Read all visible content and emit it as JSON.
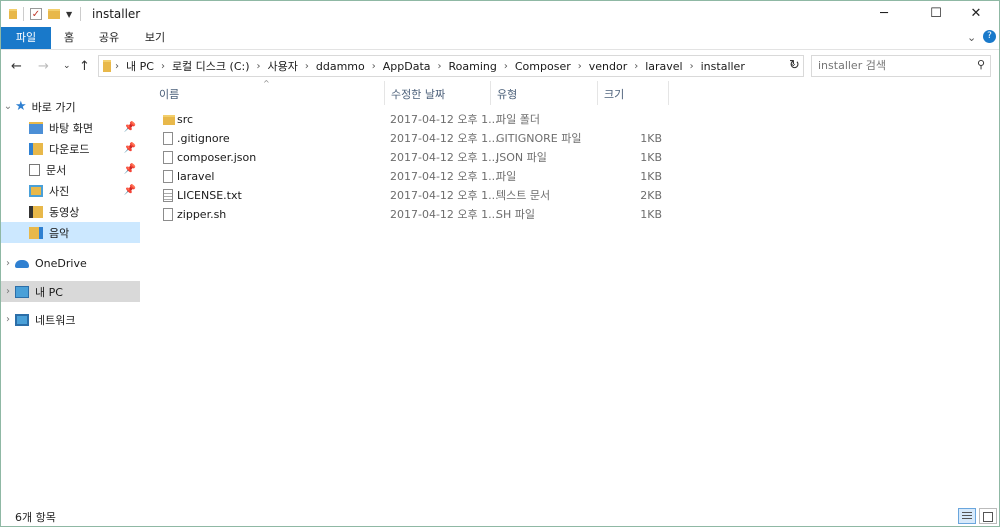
{
  "window": {
    "title": "installer"
  },
  "ribbon": {
    "tabs": [
      "파일",
      "홈",
      "공유",
      "보기"
    ]
  },
  "address": {
    "breadcrumbs": [
      "내 PC",
      "로컬 디스크 (C:)",
      "사용자",
      "ddammo",
      "AppData",
      "Roaming",
      "Composer",
      "vendor",
      "laravel",
      "installer"
    ]
  },
  "search": {
    "placeholder": "installer 검색"
  },
  "nav": {
    "quick_access": "바로 가기",
    "items": [
      {
        "label": "바탕 화면",
        "pinned": true
      },
      {
        "label": "다운로드",
        "pinned": true
      },
      {
        "label": "문서",
        "pinned": true
      },
      {
        "label": "사진",
        "pinned": true
      },
      {
        "label": "동영상",
        "pinned": false
      },
      {
        "label": "음악",
        "pinned": false,
        "selected": true
      }
    ],
    "onedrive": "OneDrive",
    "this_pc": "내 PC",
    "network": "네트워크"
  },
  "columns": {
    "name": "이름",
    "date": "수정한 날짜",
    "type": "유형",
    "size": "크기"
  },
  "files": [
    {
      "name": "src",
      "date": "2017-04-12 오후 1...",
      "type": "파일 폴더",
      "size": "",
      "icon": "folder"
    },
    {
      "name": ".gitignore",
      "date": "2017-04-12 오후 1...",
      "type": "GITIGNORE 파일",
      "size": "1KB",
      "icon": "file"
    },
    {
      "name": "composer.json",
      "date": "2017-04-12 오후 1...",
      "type": "JSON 파일",
      "size": "1KB",
      "icon": "file"
    },
    {
      "name": "laravel",
      "date": "2017-04-12 오후 1...",
      "type": "파일",
      "size": "1KB",
      "icon": "file"
    },
    {
      "name": "LICENSE.txt",
      "date": "2017-04-12 오후 1...",
      "type": "텍스트 문서",
      "size": "2KB",
      "icon": "text"
    },
    {
      "name": "zipper.sh",
      "date": "2017-04-12 오후 1...",
      "type": "SH 파일",
      "size": "1KB",
      "icon": "file"
    }
  ],
  "status": {
    "count": "6개 항목"
  },
  "colors": {
    "accent": "#1979ca",
    "selected": "#cce8ff",
    "folder": "#e8b84a"
  }
}
